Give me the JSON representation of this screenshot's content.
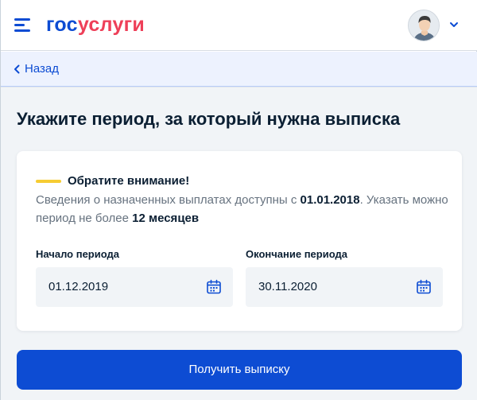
{
  "header": {
    "logo_part1": "гос",
    "logo_part2": "услуги",
    "menu_icon": "burger-menu-icon",
    "avatar_icon": "user-avatar",
    "profile_chevron_icon": "chevron-down-icon"
  },
  "nav": {
    "back_label": "Назад",
    "back_icon": "chevron-left-icon"
  },
  "page": {
    "title": "Укажите период, за который нужна выписка"
  },
  "notice": {
    "title": "Обратите внимание!",
    "text_before_date": "Сведения о назначенных выплатах доступны с ",
    "date": "01.01.2018",
    "text_after_date": ". Указать можно период не более ",
    "period": "12 месяцев"
  },
  "form": {
    "start": {
      "label": "Начало периода",
      "value": "01.12.2019"
    },
    "end": {
      "label": "Окончание периода",
      "value": "30.11.2020"
    },
    "calendar_icon": "calendar-icon"
  },
  "actions": {
    "submit_label": "Получить выписку"
  },
  "colors": {
    "brand_blue": "#0d4cd3",
    "brand_red": "#ee3f58",
    "notice_yellow": "#f6cc33",
    "page_bg": "#f1f4f7",
    "backbar_bg": "#edf2fe"
  }
}
